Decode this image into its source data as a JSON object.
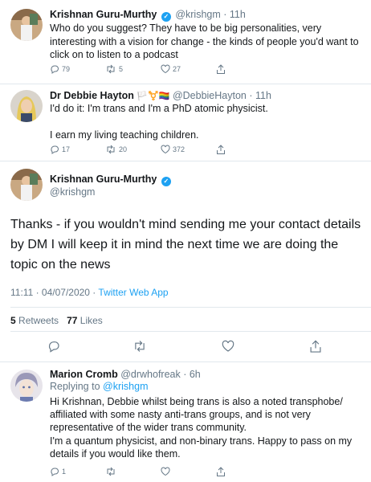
{
  "tweets": [
    {
      "name": "Krishnan Guru-Murthy",
      "handle": "@krishgm · 11h",
      "text": "Who do you suggest? They have to be big personalities, very interesting with a vision for change - the kinds of people you'd want to click on to listen to a podcast",
      "replies": "79",
      "retweets": "5",
      "likes": "27"
    },
    {
      "name": "Dr Debbie Hayton",
      "name_emoji": "🏳️⚧️🏳️‍🌈",
      "handle": "@DebbieHayton · 11h",
      "text_line1": "I'd do it: I'm trans and I'm a PhD atomic physicist.",
      "text_line2": "I earn my living teaching children.",
      "replies": "17",
      "retweets": "20",
      "likes": "372"
    }
  ],
  "main_tweet": {
    "name": "Krishnan Guru-Murthy",
    "handle": "@krishgm",
    "text": "Thanks - if you wouldn't mind sending me your contact details by DM I will keep it in mind the next time we are doing the topic on the news",
    "time": "11:11 · 04/07/2020 · ",
    "source": "Twitter Web App",
    "retweets_count": "5",
    "retweets_label": "Retweets",
    "likes_count": "77",
    "likes_label": "Likes"
  },
  "reply": {
    "name": "Marion Cromb",
    "handle": "@drwhofreak · 6h",
    "replying_prefix": "Replying to",
    "replying_handle": "@krishgm",
    "text_line1": "Hi Krishnan, Debbie whilst being trans is also a noted transphobe/",
    "text_line2": "affiliated with some nasty anti-trans groups, and is not very",
    "text_line3": "representative of the wider trans community.",
    "text_line4": "I'm a quantum physicist, and non-binary trans. Happy to pass on my",
    "text_line5": "details if you would like them.",
    "replies": "1"
  },
  "colors": {
    "accent": "#1da1f2",
    "secondary_text": "#657786",
    "divider": "#e1e8ed"
  }
}
